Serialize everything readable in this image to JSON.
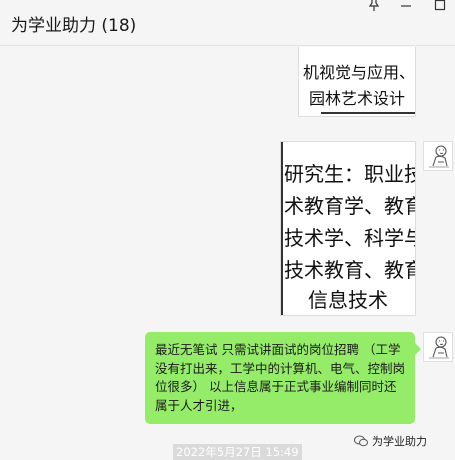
{
  "window": {
    "title": "为学业助力 (18)",
    "controls": {
      "pin_icon": "pin-icon",
      "minimize_icon": "minimize-icon",
      "maximize_icon": "maximize-icon"
    }
  },
  "messages": {
    "image1": {
      "line1": "机视觉与应用、",
      "line2": "园林艺术设计"
    },
    "image2": {
      "line1": "研究生：职业技",
      "line2": "术教育学、教育",
      "line3": "技术学、科学与",
      "line4": "技术教育、教育",
      "line5": "信息技术"
    },
    "text": "最近无笔试  只需试讲面试的岗位招聘 （工学没有打出来，工学中的计算机、电气、控制岗位很多）    以上信息属于正式事业编制同时还属于人才引进，",
    "timestamp": "2022年5月27日 15:49"
  },
  "watermark": {
    "text": "为学业助力",
    "icon": "wechat-logo-icon"
  },
  "colors": {
    "bubble_green": "#95ec69",
    "background": "#f5f5f5"
  }
}
